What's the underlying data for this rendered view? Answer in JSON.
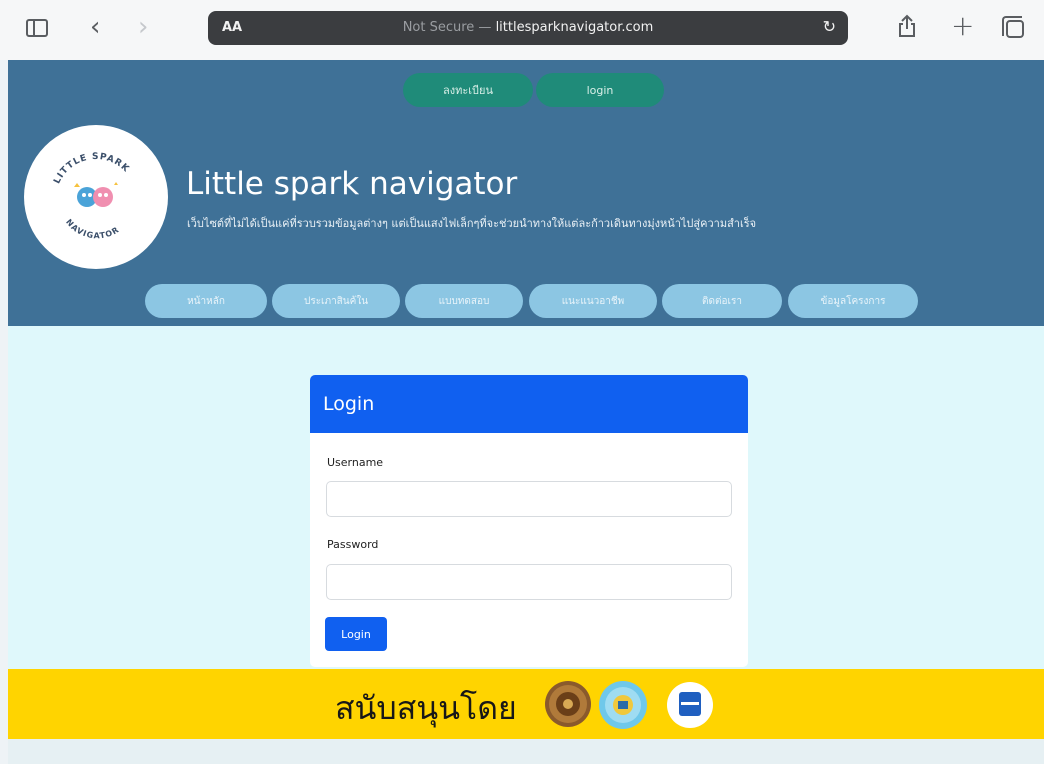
{
  "browser": {
    "text_size_label": "AA",
    "url_prefix": "Not Secure —",
    "url_host": "littlesparknavigator.com"
  },
  "header": {
    "register_label": "ลงทะเบียน",
    "login_label": "login",
    "site_title": "Little spark navigator",
    "site_subtitle": "เว็บไซต์ที่ไม่ได้เป็นแค่ที่รวบรวมข้อมูลต่างๆ แต่เป็นแสงไฟเล็กๆที่จะช่วยนำทางให้แต่ละก้าวเดินทางมุ่งหน้าไปสู่ความสำเร็จ",
    "logo_text_top": "LITTLE SPARK",
    "logo_text_bottom": "NAVIGATOR",
    "nav": [
      {
        "label": "หน้าหลัก"
      },
      {
        "label": "ประเภาสินค้ใน"
      },
      {
        "label": "แบบทดสอบ"
      },
      {
        "label": "แนะแนวอาชีพ"
      },
      {
        "label": "ติดต่อเรา"
      },
      {
        "label": "ข้อมูลโครงการ"
      }
    ]
  },
  "login_card": {
    "title": "Login",
    "username_label": "Username",
    "password_label": "Password",
    "username_value": "",
    "password_value": "",
    "submit_label": "Login"
  },
  "sponsor": {
    "label": "สนับสนุนโดย"
  },
  "colors": {
    "header_bg": "#3f7197",
    "accent_green": "#1f8b79",
    "nav_pill": "#8cc6e3",
    "content_bg": "#dff8fb",
    "primary_blue": "#1060f0",
    "sponsor_yellow": "#ffd400"
  }
}
